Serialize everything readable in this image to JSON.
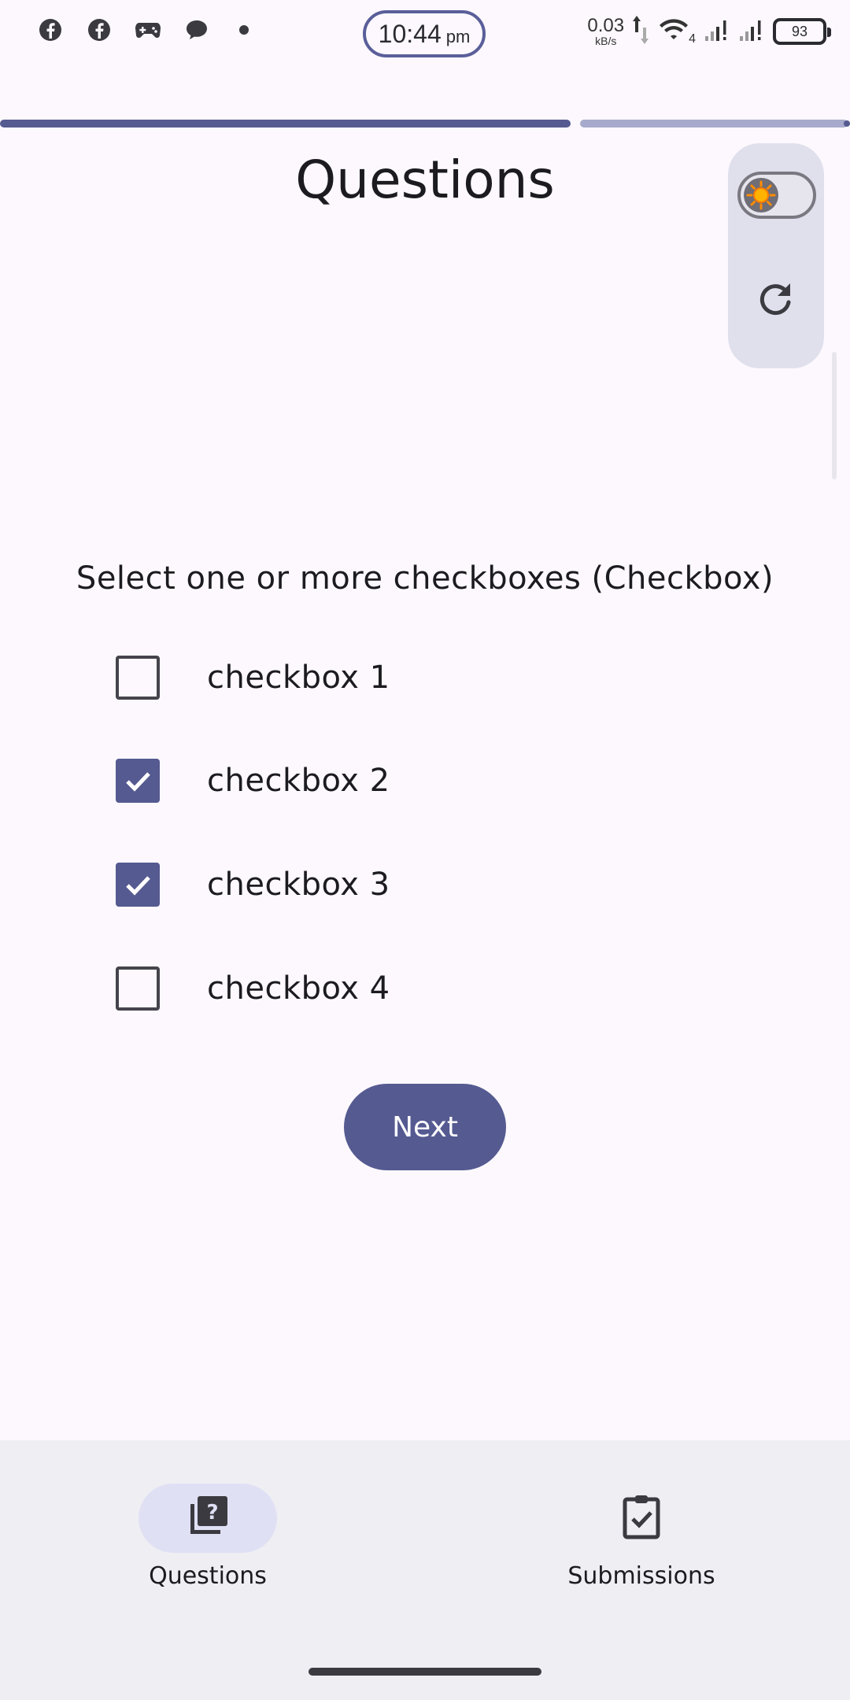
{
  "status_bar": {
    "time": "10:44",
    "ampm": "pm",
    "net_speed_value": "0.03",
    "net_speed_unit": "kB/s",
    "network_type": "4",
    "battery_level": "93",
    "notification_icons": [
      "facebook-icon",
      "facebook-icon",
      "game-controller-icon",
      "chat-bubble-icon",
      "more-dot-icon"
    ]
  },
  "progress": {
    "fraction": 0.67
  },
  "page": {
    "title": "Questions"
  },
  "controls": {
    "theme_toggle_state": "light",
    "refresh_icon": "refresh-icon"
  },
  "question": {
    "prompt": "Select one or more checkboxes (Checkbox)",
    "options": [
      {
        "label": "checkbox 1",
        "checked": false
      },
      {
        "label": "checkbox 2",
        "checked": true
      },
      {
        "label": "checkbox 3",
        "checked": true
      },
      {
        "label": "checkbox 4",
        "checked": false
      }
    ],
    "next_label": "Next"
  },
  "bottom_nav": {
    "items": [
      {
        "label": "Questions",
        "icon": "question-library-icon",
        "active": true
      },
      {
        "label": "Submissions",
        "icon": "clipboard-check-icon",
        "active": false
      }
    ]
  },
  "colors": {
    "accent": "#555a91",
    "background": "#fcf8fd",
    "nav_background": "#efeef3"
  }
}
